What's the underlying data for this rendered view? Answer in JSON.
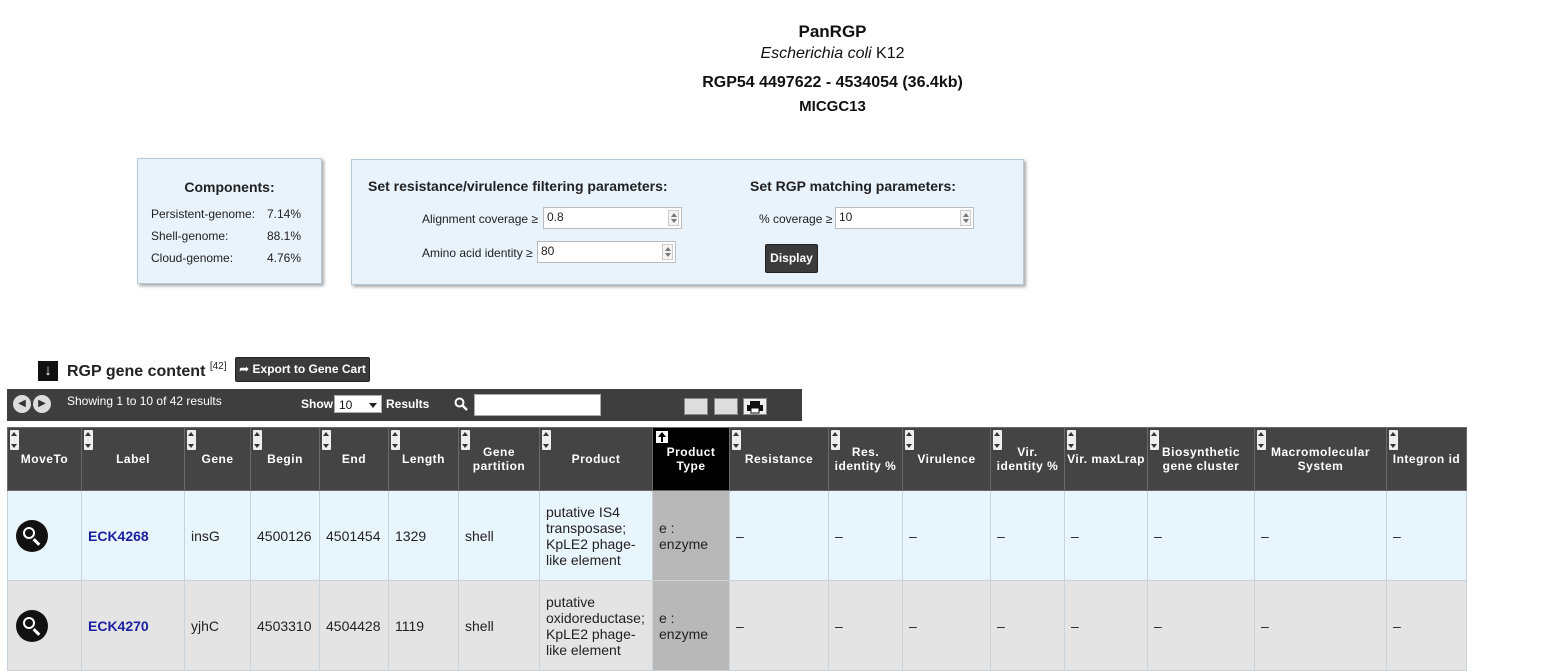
{
  "header": {
    "title": "PanRGP",
    "organism_italic": "Escherichia coli",
    "organism_strain": " K12",
    "region": "RGP54  4497622 - 4534054 (36.4kb)",
    "cluster": "MICGC13"
  },
  "components": {
    "title": "Components:",
    "rows": [
      {
        "label": "Persistent-genome:",
        "value": "7.14%"
      },
      {
        "label": "Shell-genome:",
        "value": "88.1%"
      },
      {
        "label": "Cloud-genome:",
        "value": "4.76%"
      }
    ]
  },
  "filters": {
    "resvir_title": "Set resistance/virulence filtering parameters:",
    "alignment_label": "Alignment coverage ≥",
    "alignment_value": "0.8",
    "identity_label": "Amino acid identity ≥",
    "identity_value": "80",
    "rgp_title": "Set RGP matching parameters:",
    "coverage_label": "% coverage ≥",
    "coverage_value": "10",
    "display_button": "Display"
  },
  "gene_content": {
    "title": "RGP gene content",
    "count": "[42]",
    "export_button": "Export to Gene Cart",
    "arrow_glyph": "🠛"
  },
  "toolbar": {
    "info": "Showing 1 to 10 of 42 results",
    "show_label": "Show",
    "page_size": "10",
    "results_label": "Results",
    "search_value": ""
  },
  "table": {
    "columns": [
      "MoveTo",
      "Label",
      "Gene",
      "Begin",
      "End",
      "Length",
      "Gene partition",
      "Product",
      "Product Type",
      "Resistance",
      "Res. identity %",
      "Virulence",
      "Vir. identity %",
      "Vir. maxLrap",
      "Biosynthetic gene cluster",
      "Macromolecular System",
      "Integron id"
    ],
    "rows": [
      {
        "label": "ECK4268",
        "gene": "insG",
        "begin": "4500126",
        "end": "4501454",
        "length": "1329",
        "partition": "shell",
        "product": "putative IS4 transposase; KpLE2 phage-like element",
        "ptype": "e : enzyme",
        "resistance": "–",
        "res_id": "–",
        "virulence": "–",
        "vir_id": "–",
        "vir_max": "–",
        "bgc": "–",
        "macro": "–",
        "integron": "–"
      },
      {
        "label": "ECK4270",
        "gene": "yjhC",
        "begin": "4503310",
        "end": "4504428",
        "length": "1119",
        "partition": "shell",
        "product": "putative oxidoreductase; KpLE2 phage-like element",
        "ptype": "e : enzyme",
        "resistance": "–",
        "res_id": "–",
        "virulence": "–",
        "vir_id": "–",
        "vir_max": "–",
        "bgc": "–",
        "macro": "–",
        "integron": "–"
      }
    ]
  }
}
